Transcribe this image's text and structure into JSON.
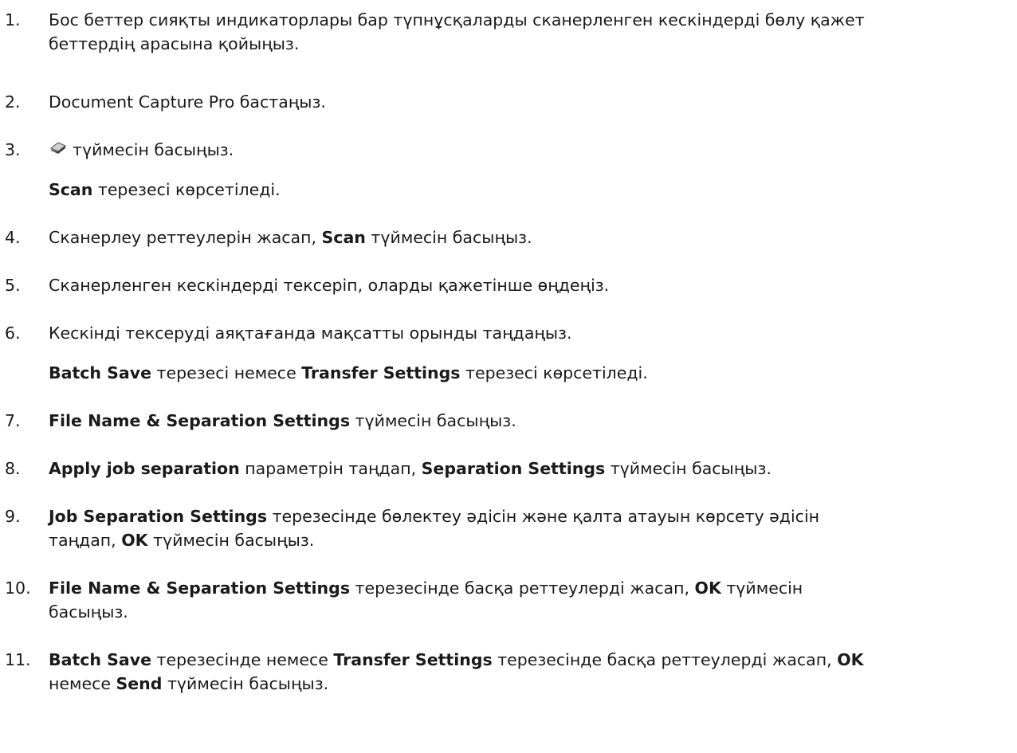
{
  "steps": [
    {
      "number": "1.",
      "lines": [
        "Бос беттер сияқты индикаторлары бар түпнұсқаларды сканерленген кескіндерді бөлу қажет",
        "беттердің арасына қойыңыз."
      ]
    },
    {
      "number": "2.",
      "text": "Document Capture Pro бастаңыз."
    },
    {
      "number": "3.",
      "icon": "scan-icon",
      "text": "түймесін басыңыз.",
      "note_bold": "Scan",
      "note_text": " терезесі көрсетіледі."
    },
    {
      "number": "4.",
      "text_a": "Сканерлеу реттеулерін жасап, ",
      "bold_a": "Scan",
      "text_b": " түймесін басыңыз."
    },
    {
      "number": "5.",
      "text": "Сканерленген кескіндерді тексеріп, оларды қажетінше өңдеңіз."
    },
    {
      "number": "6.",
      "text": "Кескінді тексеруді аяқтағанда мақсатты орынды таңдаңыз.",
      "note_bold_a": "Batch Save",
      "note_text_a": " терезесі немесе ",
      "note_bold_b": "Transfer Settings",
      "note_text_b": " терезесі көрсетіледі."
    },
    {
      "number": "7.",
      "bold_a": "File Name & Separation Settings",
      "text_a": " түймесін басыңыз."
    },
    {
      "number": "8.",
      "bold_a": "Apply job separation",
      "text_a": " параметрін таңдап, ",
      "bold_b": "Separation Settings",
      "text_b": " түймесін басыңыз."
    },
    {
      "number": "9.",
      "bold_a": "Job Separation Settings",
      "text_a": " терезесінде бөлектеу әдісін және қалта атауын көрсету әдісін",
      "text_b": "таңдап, ",
      "bold_b": "OK",
      "text_c": " түймесін басыңыз."
    },
    {
      "number": "10.",
      "bold_a": "File Name & Separation Settings",
      "text_a": " терезесінде басқа реттеулерді жасап, ",
      "bold_b": "OK",
      "text_b": " түймесін",
      "text_c": "басыңыз."
    },
    {
      "number": "11.",
      "bold_a": "Batch Save",
      "text_a": " терезесінде немесе ",
      "bold_b": "Transfer Settings",
      "text_b": " терезесінде басқа реттеулерді жасап, ",
      "bold_c": "OK",
      "text_c": "немесе ",
      "bold_d": "Send",
      "text_d": " түймесін басыңыз."
    }
  ]
}
